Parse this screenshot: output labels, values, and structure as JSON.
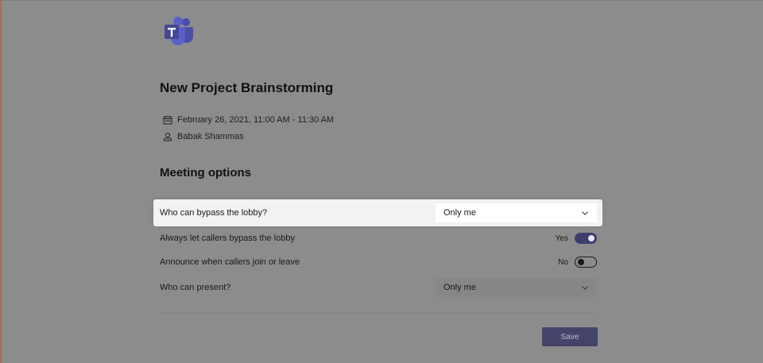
{
  "meeting": {
    "title": "New Project Brainstorming",
    "datetime": "February 26, 2021, 11:00 AM - 11:30 AM",
    "organizer": "Babak Shammas"
  },
  "options": {
    "section_title": "Meeting options",
    "bypass_lobby": {
      "label": "Who can bypass the lobby?",
      "value": "Only me"
    },
    "callers_bypass": {
      "label": "Always let callers bypass the lobby",
      "state_text": "Yes",
      "enabled": true
    },
    "announce_callers": {
      "label": "Announce when callers join or leave",
      "state_text": "No",
      "enabled": false
    },
    "who_can_present": {
      "label": "Who can present?",
      "value": "Only me"
    }
  },
  "actions": {
    "save_label": "Save"
  },
  "icons": {
    "logo": "teams-logo-icon",
    "date": "calendar-icon",
    "organizer": "person-icon",
    "dropdown": "chevron-down-icon"
  },
  "colors": {
    "overlay_background": "#8c8c8c",
    "accent": "#44436a",
    "toggle_on": "#3f3d6e",
    "highlight_row": "#f3f2f1"
  }
}
